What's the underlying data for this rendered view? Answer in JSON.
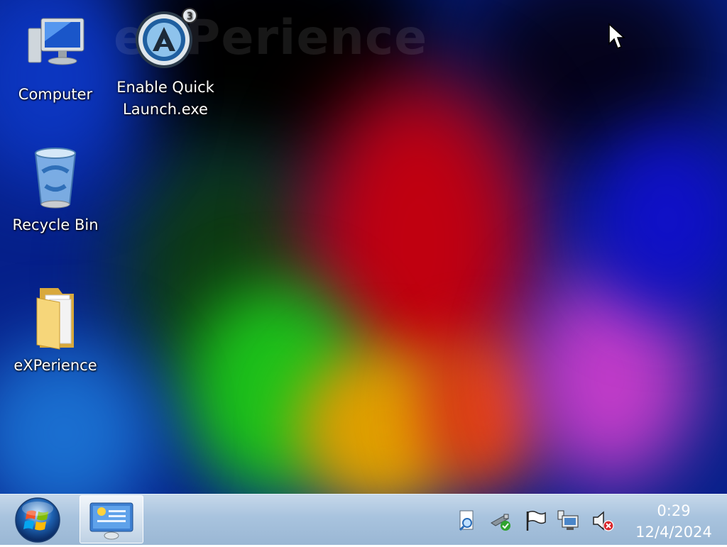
{
  "desktop": {
    "wallpaper_brand": "eXPerience",
    "icons": [
      {
        "label": "Computer",
        "icon": "computer-icon"
      },
      {
        "label": "Enable Quick Launch.exe",
        "icon": "quick-launch-app-icon"
      },
      {
        "label": "Recycle Bin",
        "icon": "recycle-bin-icon"
      },
      {
        "label": "eXPerience",
        "icon": "folder-icon"
      }
    ]
  },
  "taskbar": {
    "start_icon": "windows-logo-icon",
    "pinned_app_icon": "control-panel-icon",
    "tray_icons": [
      "action-center-search-icon",
      "usb-device-icon",
      "flag-icon",
      "network-icon",
      "volume-muted-icon"
    ],
    "clock": {
      "time": "0:29",
      "date": "12/4/2024"
    }
  },
  "colors": {
    "taskbar": "#a8c3de",
    "wallpaper_base": "#06208a"
  }
}
